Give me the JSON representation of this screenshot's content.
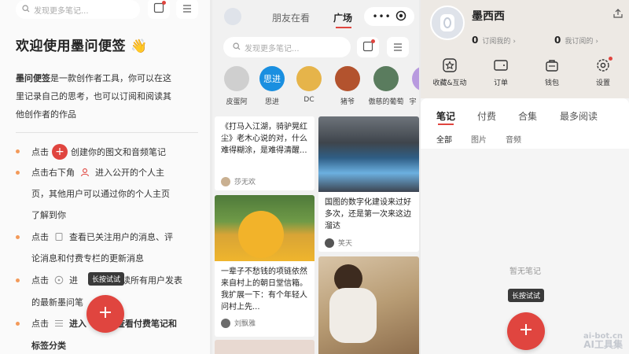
{
  "colors": {
    "accent": "#e0453f",
    "bullet": "#f39a5a",
    "tooltip_bg": "#3a3a3a"
  },
  "panel1": {
    "search_placeholder": "发现更多笔记...",
    "title": "欢迎使用墨问便签 👋",
    "desc_bold": "墨问便签",
    "desc_rest_1": "是一款创作者工具，你可以在这",
    "desc_line2": "里记录自己的思考，也可以订阅和阅读其",
    "desc_line3": "他创作者的作品",
    "items": [
      {
        "pre": "点击",
        "post": "创建你的图文和音频笔记"
      },
      {
        "pre": "点击右下角",
        "post": "进入公开的个人主",
        "cont1": "页，其他用户可以通过你的个人主页",
        "cont2": "了解到你"
      },
      {
        "pre": "点击",
        "post": "查看已关注用户的消息、评",
        "cont1": "论消息和付费专栏的更新消息"
      },
      {
        "pre": "点击",
        "post": "进",
        "post2": "读所有用户发表",
        "cont1": "的最新墨问笔"
      },
      {
        "pre": "点击",
        "post": "进入",
        "post2": "查看付费笔记和",
        "cont1": "标签分类"
      }
    ],
    "tooltip": "长按试试"
  },
  "panel2": {
    "tabs": [
      "朋友在看",
      "广场"
    ],
    "search_placeholder": "发现更多笔记...",
    "avatars": [
      "皮蛋阿",
      "思进",
      "DC",
      "猪爷",
      "傲慈的葡萄",
      "宇"
    ],
    "cards": [
      {
        "text": "《打马入江湖，骑驴晃红尘》老木心说的对，什么难得糊涂，是难得清醒...",
        "author": "莎无欢"
      },
      {
        "text": "国图的数字化建设来过好多次，还是第一次来这边溜达",
        "author": "笑天"
      },
      {
        "text": "一辈子不愁钱的项链依然来自村上的朝日堂信箱。我扩展一下：有个年轻人问村上先...",
        "author": "刘飘雅"
      }
    ]
  },
  "panel3": {
    "username": "墨西西",
    "stats": [
      {
        "num": "0",
        "label": "订阅我的"
      },
      {
        "num": "0",
        "label": "我订阅的"
      }
    ],
    "menu": [
      "收藏&互动",
      "订单",
      "钱包",
      "设置"
    ],
    "tabs": [
      "笔记",
      "付费",
      "合集",
      "最多阅读"
    ],
    "subtabs": [
      "全部",
      "图片",
      "音频"
    ],
    "empty": "暂无笔记",
    "tooltip": "长按试试",
    "watermark_1": "ai-bot.cn",
    "watermark_2": "AI工具集"
  }
}
